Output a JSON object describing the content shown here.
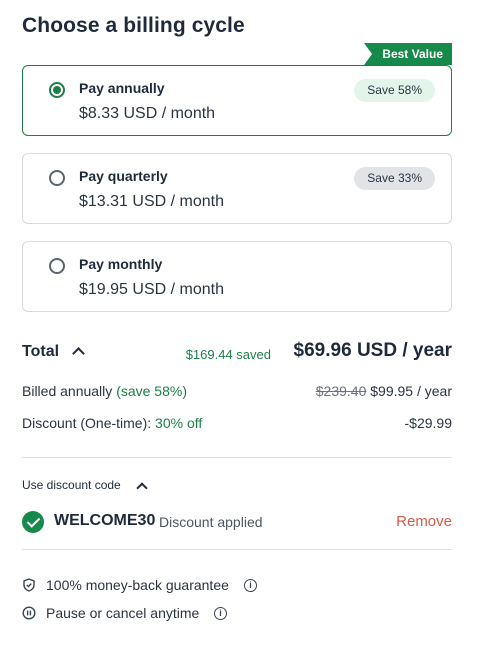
{
  "page": {
    "title": "Choose a billing cycle"
  },
  "best_value_label": "Best Value",
  "plans": [
    {
      "name": "Pay annually",
      "price": "$8.33 USD / month",
      "badge": "Save 58%",
      "selected": true
    },
    {
      "name": "Pay quarterly",
      "price": "$13.31 USD / month",
      "badge": "Save 33%",
      "selected": false
    },
    {
      "name": "Pay monthly",
      "price": "$19.95 USD / month",
      "badge": "",
      "selected": false
    }
  ],
  "total": {
    "label": "Total",
    "saved": "$169.44 saved",
    "price": "$69.96 USD / year"
  },
  "billed": {
    "label": "Billed annually",
    "save": "(save 58%)",
    "original": "$239.40",
    "price": "$99.95 / year"
  },
  "discount": {
    "label": "Discount (One-time):",
    "value": "30% off",
    "amount": "-$29.99"
  },
  "discount_code": {
    "label": "Use discount code",
    "code": "WELCOME30",
    "status": "Discount applied",
    "remove": "Remove"
  },
  "assurances": [
    {
      "icon": "shield-icon",
      "text": "100% money-back guarantee"
    },
    {
      "icon": "pause-icon",
      "text": "Pause or cancel anytime"
    }
  ],
  "colors": {
    "accent": "#158a4a",
    "remove": "#d35a4a",
    "text": "#1e2a3b"
  }
}
